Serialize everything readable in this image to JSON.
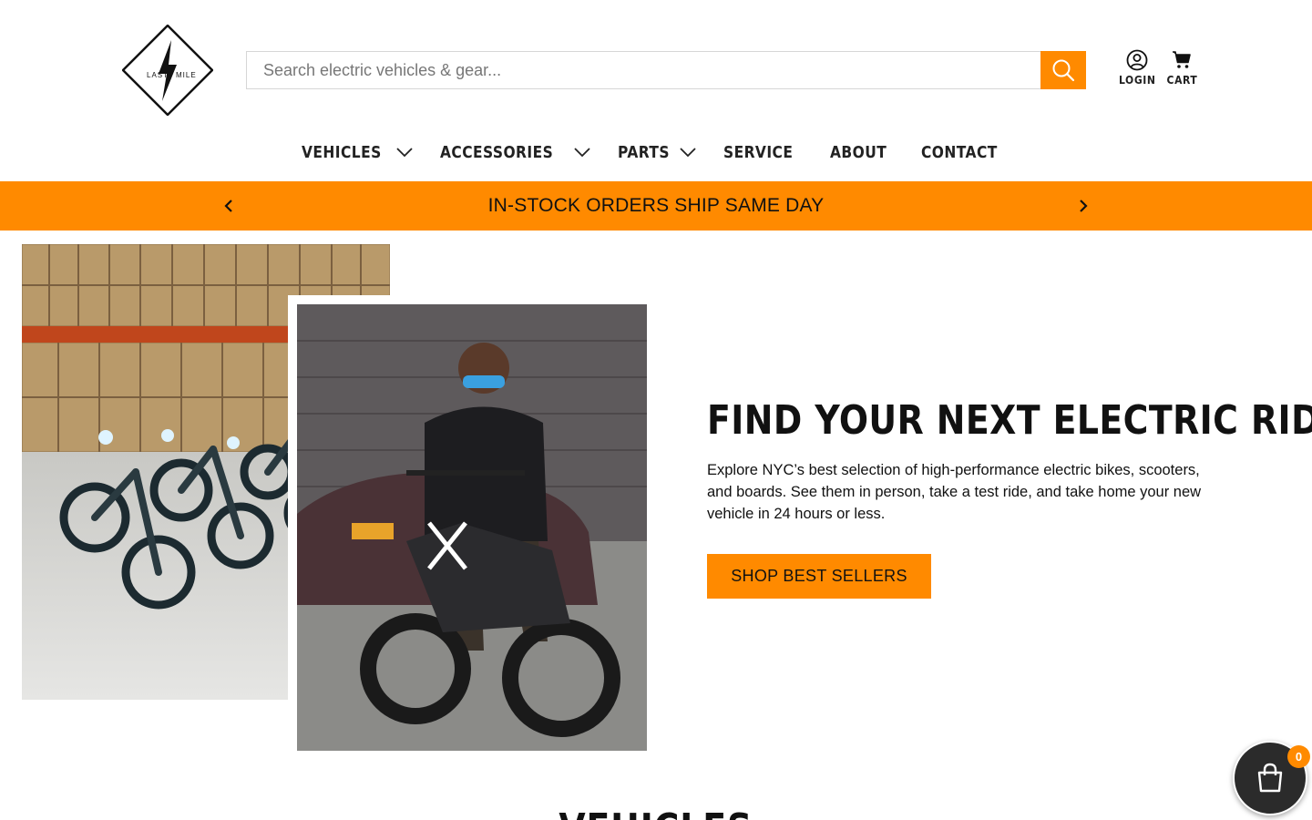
{
  "brand": {
    "logo_text_left": "LAST",
    "logo_text_right": "MILE",
    "accent_color": "#ff8a00"
  },
  "search": {
    "placeholder": "Search electric vehicles & gear...",
    "button_icon": "search-icon"
  },
  "header": {
    "login_label": "LOGIN",
    "cart_label": "CART",
    "login_icon": "user-icon",
    "cart_icon": "cart-icon"
  },
  "nav": {
    "items": [
      {
        "label": "VEHICLES",
        "has_dropdown": true
      },
      {
        "label": "ACCESSORIES",
        "has_dropdown": true
      },
      {
        "label": "PARTS",
        "has_dropdown": true
      },
      {
        "label": "SERVICE",
        "has_dropdown": false
      },
      {
        "label": "ABOUT",
        "has_dropdown": false
      },
      {
        "label": "CONTACT",
        "has_dropdown": false
      }
    ]
  },
  "announcement": {
    "text": "IN-STOCK ORDERS SHIP SAME DAY"
  },
  "hero": {
    "title": "FIND YOUR NEXT ELECTRIC RIDE",
    "description": "Explore NYC’s best selection of high-performance electric bikes, scooters, and boards. See them in person, take a test ride, and take home your new vehicle in 24 hours or less.",
    "button_label": "SHOP BEST SELLERS"
  },
  "section": {
    "heading": "VEHICLES"
  },
  "floating_cart": {
    "count": "0",
    "icon": "shopping-bag-icon"
  }
}
